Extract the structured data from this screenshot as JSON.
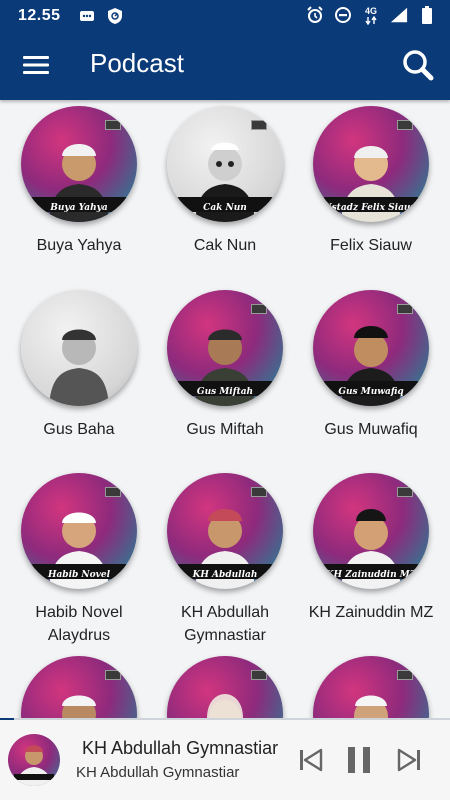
{
  "status_bar": {
    "time": "12.55",
    "left_icons": [
      "message-icon",
      "shield-icon"
    ],
    "right_icons": [
      "alarm-icon",
      "dnd-icon",
      "4g-signal-icon",
      "battery-icon"
    ],
    "network": "4G"
  },
  "app_bar": {
    "title": "Podcast",
    "menu_icon": "hamburger-icon",
    "search_icon": "search-icon"
  },
  "podcasts": [
    {
      "name": "Buya Yahya",
      "banner": "Buya Yahya"
    },
    {
      "name": "Cak Nun",
      "banner": "Cak Nun"
    },
    {
      "name": "Felix Siauw",
      "banner": "Ustadz Felix Siauw"
    },
    {
      "name": "Gus Baha",
      "banner": ""
    },
    {
      "name": "Gus Miftah",
      "banner": "Gus Miftah"
    },
    {
      "name": "Gus Muwafiq",
      "banner": "Gus Muwafiq"
    },
    {
      "name": "Habib Novel Alaydrus",
      "banner": "Habib Novel Alaydrus"
    },
    {
      "name": "KH Abdullah Gymnastiar",
      "banner": "KH Abdullah Gymnastiar"
    },
    {
      "name": "KH Zainuddin MZ",
      "banner": "KH Zainuddin MZ"
    },
    {
      "name": "",
      "banner": ""
    },
    {
      "name": "",
      "banner": ""
    },
    {
      "name": "",
      "banner": ""
    }
  ],
  "player": {
    "title": "KH Abdullah Gymnastiar",
    "subtitle": "KH Abdullah Gymnastiar",
    "progress": 0.03,
    "controls": [
      "skip-previous-icon",
      "pause-icon",
      "skip-next-icon"
    ]
  }
}
